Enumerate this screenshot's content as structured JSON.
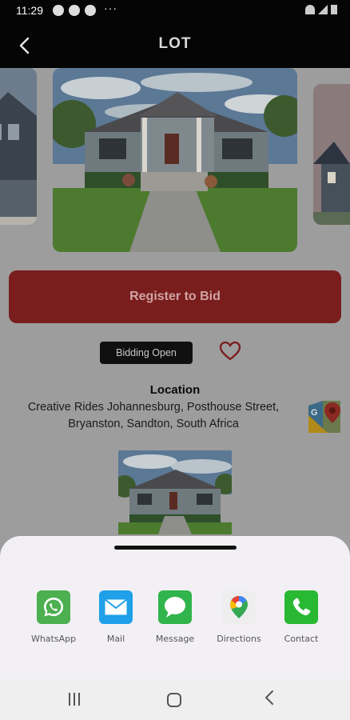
{
  "status_bar": {
    "time": "11:29",
    "more": "···"
  },
  "header": {
    "title": "LOT",
    "back_icon": "chevron-left-icon"
  },
  "register_button": "Register to Bid",
  "status_badge": "Bidding Open",
  "location": {
    "heading": "Location",
    "address": "Creative Rides Johannesburg, Posthouse Street, Bryanston, Sandton, South Africa"
  },
  "share_sheet": {
    "items": [
      {
        "label": "WhatsApp",
        "icon": "whatsapp-icon",
        "color": "#4caf50"
      },
      {
        "label": "Mail",
        "icon": "mail-icon",
        "color": "#1fa0e8"
      },
      {
        "label": "Message",
        "icon": "message-icon",
        "color": "#31b44b"
      },
      {
        "label": "Directions",
        "icon": "google-maps-icon",
        "color": "#eeeeee"
      },
      {
        "label": "Contact",
        "icon": "phone-icon",
        "color": "#28b832"
      }
    ]
  },
  "colors": {
    "accent_red": "#7a1d1d",
    "overlay": "#9d9d9d",
    "sheet": "#f2f0f4"
  }
}
